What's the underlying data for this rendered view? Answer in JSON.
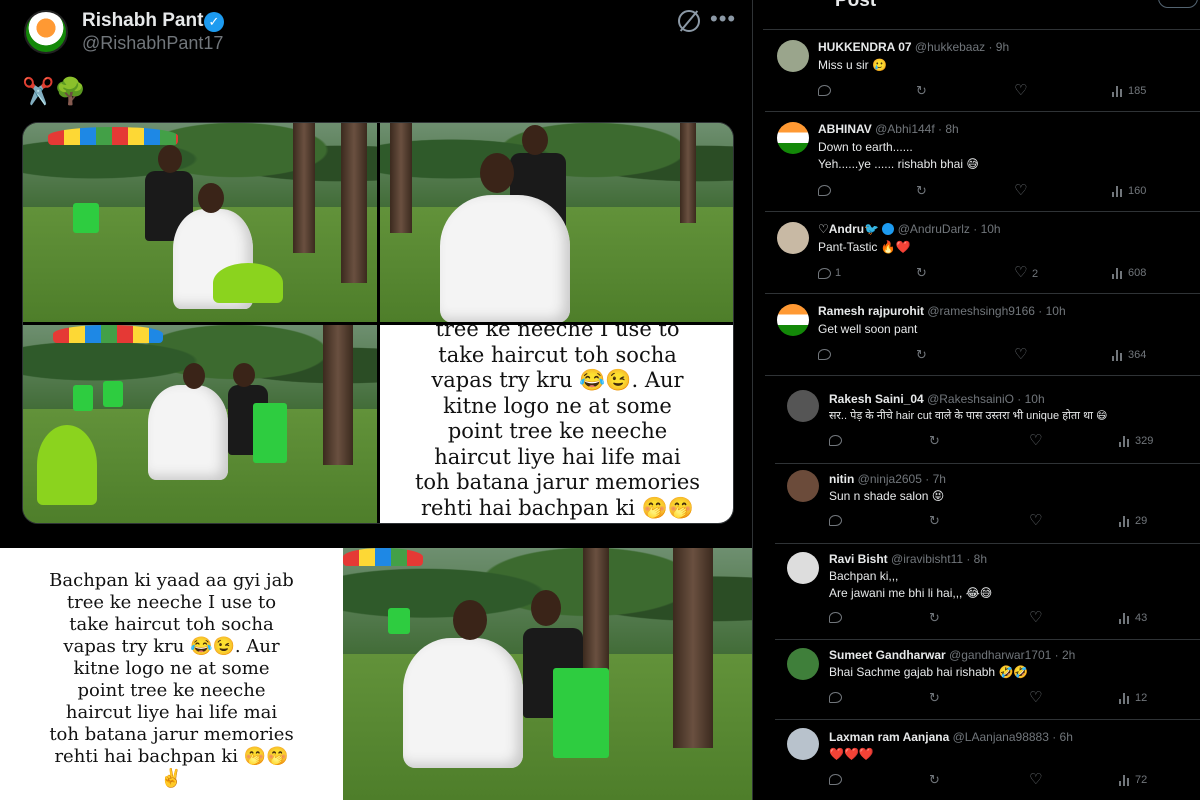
{
  "tweet": {
    "author_name": "Rishabh Pant",
    "author_handle": "@RishabhPant17",
    "emoji_line": "✂️🌳",
    "image4_text": "tree ke neeche I use to\ntake haircut toh socha\nvapas try kru 😂😉. Aur\nkitne logo ne at some\npoint tree ke neeche\nhaircut liye hai life mai\ntoh batana jarur memories\nrehti hai bachpan ki 🤭🤭"
  },
  "caption": {
    "text": "Bachpan ki yaad aa gyi jab\ntree ke neeche I use to\ntake haircut toh socha\nvapas try kru 😂😉. Aur\nkitne logo ne at some\npoint tree ke neeche\nhaircut liye hai life mai\ntoh batana jarur memories\nrehti hai bachpan ki 🤭🤭\n✌️"
  },
  "replies_header": {
    "title": "Post"
  },
  "replies": [
    {
      "name": "HUKKENDRA 07",
      "handle": "@hukkebaaz · 9h",
      "text": "Miss u sir 🥲",
      "replies": "",
      "reposts": "",
      "likes": "",
      "views": "185"
    },
    {
      "name": "ABHINAV",
      "handle": "@Abhi144f · 8h",
      "text": "Down to earth......\nYeh......ye ...... rishabh bhai 😅",
      "replies": "",
      "reposts": "",
      "likes": "",
      "views": "160"
    },
    {
      "name": "♡Andru🐦",
      "handle": "@AndruDarlz · 10h",
      "text": "Pant-Tastic 🔥❤️",
      "replies": "1",
      "reposts": "",
      "likes": "2",
      "views": "608"
    },
    {
      "name": "Ramesh rajpurohit",
      "handle": "@rameshsingh9166 · 10h",
      "text": "Get well soon pant",
      "replies": "",
      "reposts": "",
      "likes": "",
      "views": "364"
    },
    {
      "name": "Rakesh Saini_04",
      "handle": "@RakeshsainiO · 10h",
      "text": "सर.. पेड़ के नीचे hair cut वाले के पास उस्तरा भी unique होता था 😄",
      "replies": "",
      "reposts": "",
      "likes": "",
      "views": "329"
    },
    {
      "name": "nitin",
      "handle": "@ninja2605 · 7h",
      "text": "Sun n shade salon 😝",
      "replies": "",
      "reposts": "",
      "likes": "",
      "views": "29"
    },
    {
      "name": "Ravi Bisht",
      "handle": "@iravibisht11 · 8h",
      "text": "Bachpan ki,,,\nAre jawani me bhi li hai,,, 😂😅",
      "replies": "",
      "reposts": "",
      "likes": "",
      "views": "43"
    },
    {
      "name": "Sumeet Gandharwar",
      "handle": "@gandharwar1701 · 2h",
      "text": "Bhai Sachme gajab hai rishabh 🤣🤣",
      "replies": "",
      "reposts": "",
      "likes": "",
      "views": "12"
    },
    {
      "name": "Laxman ram Aanjana",
      "handle": "@LAanjana98883 · 6h",
      "text": "❤️❤️❤️",
      "replies": "",
      "reposts": "",
      "likes": "",
      "views": "72"
    }
  ],
  "colors": {
    "background": "#000000",
    "text_primary": "#e7e9ea",
    "text_secondary": "#71767b",
    "verified_blue": "#1d9bf0",
    "divider": "#2f3336"
  },
  "icons": [
    "grok-icon",
    "more-icon",
    "verified-badge-icon",
    "reply-icon",
    "repost-icon",
    "like-icon",
    "views-icon"
  ]
}
